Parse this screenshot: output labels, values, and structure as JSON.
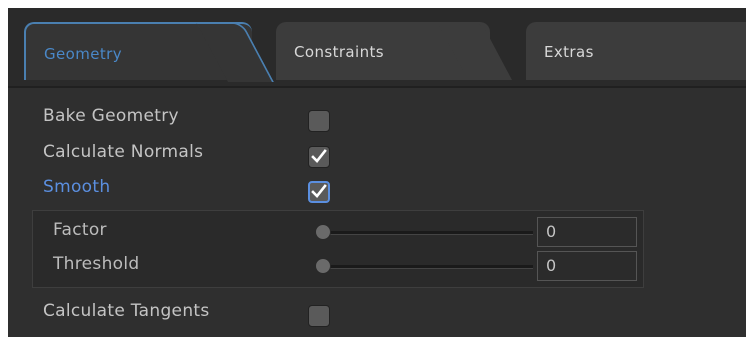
{
  "tabs": [
    {
      "label": "Geometry",
      "active": true
    },
    {
      "label": "Constraints",
      "active": false
    },
    {
      "label": "Extras",
      "active": false
    }
  ],
  "settings": {
    "bake_geometry": {
      "label": "Bake Geometry",
      "checked": false
    },
    "calculate_normals": {
      "label": "Calculate Normals",
      "checked": true
    },
    "smooth": {
      "label": "Smooth",
      "checked": true
    },
    "factor": {
      "label": "Factor",
      "value": "0",
      "slider_fraction": 0
    },
    "threshold": {
      "label": "Threshold",
      "value": "0",
      "slider_fraction": 0
    },
    "calculate_tangents": {
      "label": "Calculate Tangents",
      "checked": false
    }
  },
  "colors": {
    "accent": "#5b8fe0",
    "tab_active_border": "#4a7fb0",
    "panel_bg": "#2f2f2f"
  }
}
